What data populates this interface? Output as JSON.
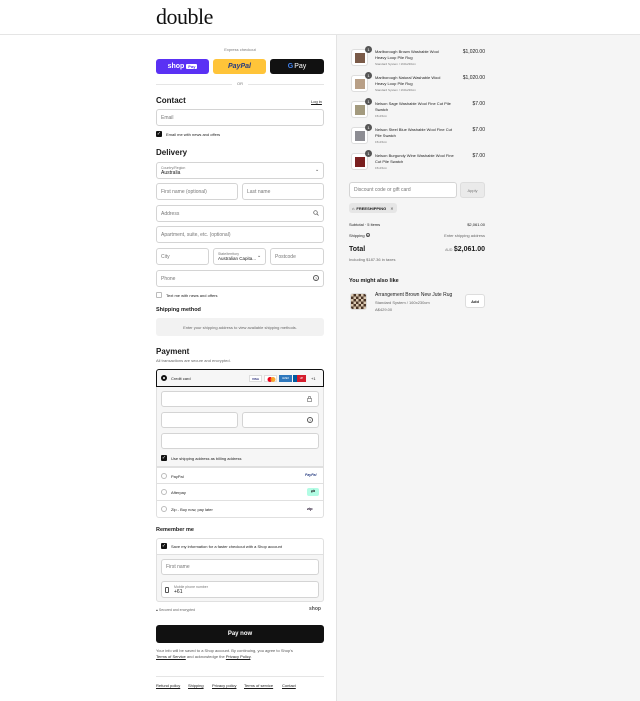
{
  "brand": {
    "logo": "double"
  },
  "express": {
    "title": "Express checkout",
    "shop_pay": "shop",
    "shop_pay_badge": "Pay",
    "paypal": "PayPal",
    "gpay_g": "G",
    "gpay_text": "Pay",
    "or": "OR"
  },
  "contact": {
    "title": "Contact",
    "login": "Log in",
    "email_placeholder": "Email",
    "news_label": "Email me with news and offers"
  },
  "delivery": {
    "title": "Delivery",
    "country_label": "Country/Region",
    "country_value": "Australia",
    "first_name": "First name (optional)",
    "last_name": "Last name",
    "address": "Address",
    "apartment": "Apartment, suite, etc. (optional)",
    "city": "City",
    "state_label": "State/territory",
    "state_value": "Australian Capita...",
    "postcode": "Postcode",
    "phone": "Phone",
    "text_label": "Text me with news and offers"
  },
  "shipping": {
    "title": "Shipping method",
    "notice": "Enter your shipping address to view available shipping methods."
  },
  "payment": {
    "title": "Payment",
    "subtitle": "All transactions are secure and encrypted.",
    "credit_card": "Credit card",
    "cards": [
      "VISA",
      "MC",
      "AMEX",
      "UP"
    ],
    "more": "+1",
    "billing_label": "Use shipping address as billing address",
    "paypal": "PayPal",
    "paypal_logo": "PayPal",
    "afterpay": "Afterpay",
    "zip": "Zip - Buy now, pay later",
    "zip_logo": "zip"
  },
  "remember": {
    "title": "Remember me",
    "save_label": "Save my information for a faster checkout with a Shop account",
    "first_name": "First name",
    "mobile_label": "Mobile phone number",
    "mobile_value": "+61",
    "secure": "Secured and encrypted",
    "shop": "shop"
  },
  "pay_now": "Pay now",
  "legal": {
    "line1": "Your info will be saved to a Shop account. By continuing, you agree to Shop's",
    "terms": "Terms of Service",
    "and": "and acknowledge the",
    "privacy": "Privacy Policy",
    "end": "."
  },
  "footer": [
    "Refund policy",
    "Shipping",
    "Privacy policy",
    "Terms of service",
    "Contact"
  ],
  "cart": {
    "items": [
      {
        "qty": "1",
        "name1": "Marlborough Brown Washable Wool",
        "name2": "Heavy Loop Pile Rug",
        "variant": "Standard System / 160x230cm",
        "price": "$1,020.00",
        "color": "#7a5a48"
      },
      {
        "qty": "1",
        "name1": "Marlborough Natural Washable Wool",
        "name2": "Heavy Loop Pile Rug",
        "variant": "Standard System / 160x230cm",
        "price": "$1,020.00",
        "color": "#b89f86"
      },
      {
        "qty": "1",
        "name1": "Nelson Sage Washable Wool Fine Cut Pile",
        "name2": "Swatch",
        "variant": "15x15cm",
        "price": "$7.00",
        "color": "#a39a7e"
      },
      {
        "qty": "1",
        "name1": "Nelson Steel Blue Washable Wool Fine Cut",
        "name2": "Pile Swatch",
        "variant": "15x15cm",
        "price": "$7.00",
        "color": "#8d8d93"
      },
      {
        "qty": "1",
        "name1": "Nelson Burgundy Wine Washable Wool Fine",
        "name2": "Cut Pile Swatch",
        "variant": "15x15cm",
        "price": "$7.00",
        "color": "#7a1f1f"
      }
    ],
    "discount_placeholder": "Discount code or gift card",
    "apply": "Apply",
    "tag": "FREESHIPPING",
    "subtotal_label": "Subtotal · 5 items",
    "subtotal": "$2,061.00",
    "shipping_label": "Shipping",
    "shipping_value": "Enter shipping address",
    "total_label": "Total",
    "currency": "AUD",
    "total": "$2,061.00",
    "taxes": "Including $187.36 in taxes"
  },
  "upsell": {
    "title": "You might also like",
    "name": "Arrangement Brown New Jute Rug",
    "variant": "Standard System / 160x230cm",
    "price": "A$429.00",
    "add": "Add"
  },
  "colors": {
    "shop_pay": "#5a31f4",
    "paypal": "#ffc439",
    "black": "#111111"
  }
}
